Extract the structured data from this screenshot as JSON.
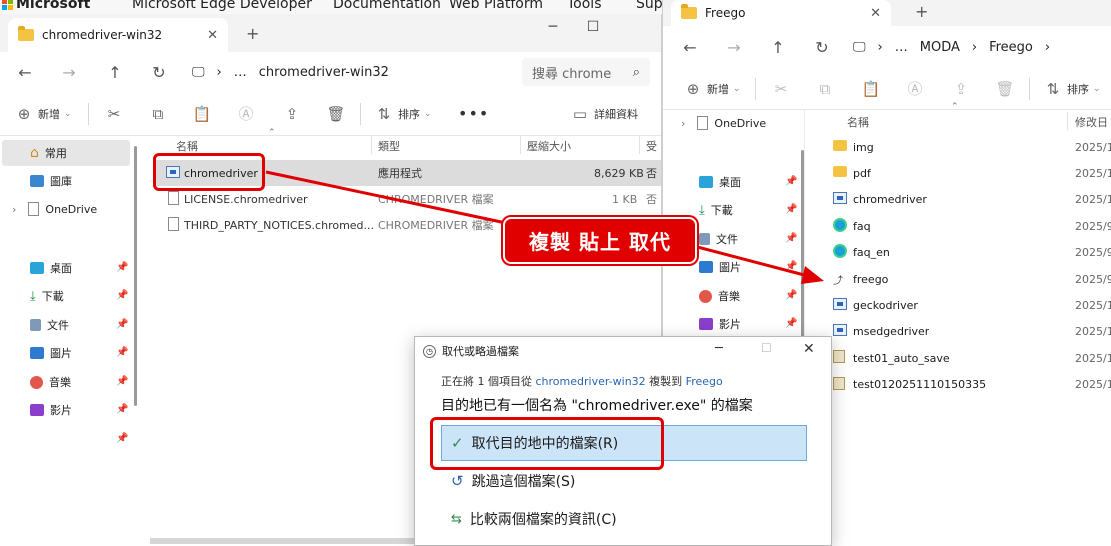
{
  "background_browser": {
    "brand": "Microsoft",
    "tabs": [
      "Microsoft Edge Developer",
      "Documentation",
      "Web Platform",
      "Tools",
      "Supp"
    ]
  },
  "left_window": {
    "tab_title": "chromedriver-win32",
    "address": {
      "ellipsis": "…",
      "path": "chromedriver-win32"
    },
    "search_placeholder": "搜尋 chrome",
    "new_label": "新增",
    "sort_label": "排序",
    "details_label": "詳細資料",
    "sidebar": {
      "home": "常用",
      "gallery": "圖庫",
      "onedrive": "OneDrive",
      "quick": [
        "桌面",
        "下載",
        "文件",
        "圖片",
        "音樂",
        "影片"
      ]
    },
    "columns": {
      "name": "名稱",
      "type": "類型",
      "size": "壓縮大小",
      "extra": "受"
    },
    "files": [
      {
        "name": "chromedriver",
        "type": "應用程式",
        "size": "8,629 KB",
        "extra": "否"
      },
      {
        "name": "LICENSE.chromedriver",
        "type": "CHROMEDRIVER 檔案",
        "size": "1 KB",
        "extra": "否"
      },
      {
        "name": "THIRD_PARTY_NOTICES.chromed...",
        "type": "CHROMEDRIVER 檔案",
        "size": "",
        "extra": "否"
      }
    ]
  },
  "right_window": {
    "tab_title": "Freego",
    "address": {
      "ellipsis": "…",
      "parent": "MODA",
      "current": "Freego"
    },
    "new_label": "新增",
    "sort_label": "排序",
    "sidebar": {
      "onedrive": "OneDrive",
      "quick": [
        "桌面",
        "下載",
        "文件",
        "圖片",
        "音樂",
        "影片"
      ]
    },
    "columns": {
      "name": "名稱",
      "modified": "修改日"
    },
    "files": [
      {
        "name": "img",
        "date": "2025/1",
        "icon": "folder"
      },
      {
        "name": "pdf",
        "date": "2025/1",
        "icon": "folder"
      },
      {
        "name": "chromedriver",
        "date": "2025/1",
        "icon": "exe"
      },
      {
        "name": "faq",
        "date": "2025/9",
        "icon": "edge"
      },
      {
        "name": "faq_en",
        "date": "2025/9",
        "icon": "edge"
      },
      {
        "name": "freego",
        "date": "2025/9",
        "icon": "shortcut"
      },
      {
        "name": "geckodriver",
        "date": "2025/1",
        "icon": "exe"
      },
      {
        "name": "msedgedriver",
        "date": "2025/1",
        "icon": "exe"
      },
      {
        "name": "test01_auto_save",
        "date": "2025/1",
        "icon": "image"
      },
      {
        "name": "test0120251110150335",
        "date": "2025/1",
        "icon": "image"
      }
    ]
  },
  "dialog": {
    "title": "取代或略過檔案",
    "info_prefix": "正在將 1 個項目從",
    "info_source": "chromedriver-win32",
    "info_middle": "複製到",
    "info_dest": "Freego",
    "message": "目的地已有一個名為 \"chromedriver.exe\" 的檔案",
    "options": [
      "取代目的地中的檔案(R)",
      "跳過這個檔案(S)",
      "比較兩個檔案的資訊(C)"
    ]
  },
  "annotation": {
    "callout": "複製 貼上 取代",
    "color": "#e00000"
  },
  "colors": {
    "folder": "#f5c342",
    "selected_row": "#dcdcdc",
    "highlight_option": "#cce4f7",
    "link": "#2a64b2"
  }
}
